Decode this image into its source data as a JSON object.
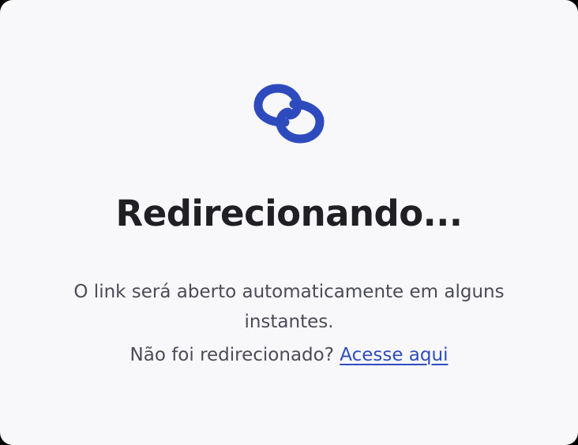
{
  "colors": {
    "background": "#f8f8fb",
    "title": "#1f1f24",
    "text": "#4b4b57",
    "link": "#2e4bbd",
    "logo": "#2e4bbd"
  },
  "logo": {
    "icon": "chain-link-icon"
  },
  "title": "Redirecionando...",
  "message": "O link será aberto automaticamente em alguns instantes.",
  "fallback": {
    "prompt": "Não foi redirecionado?",
    "link_label": "Acesse aqui"
  }
}
